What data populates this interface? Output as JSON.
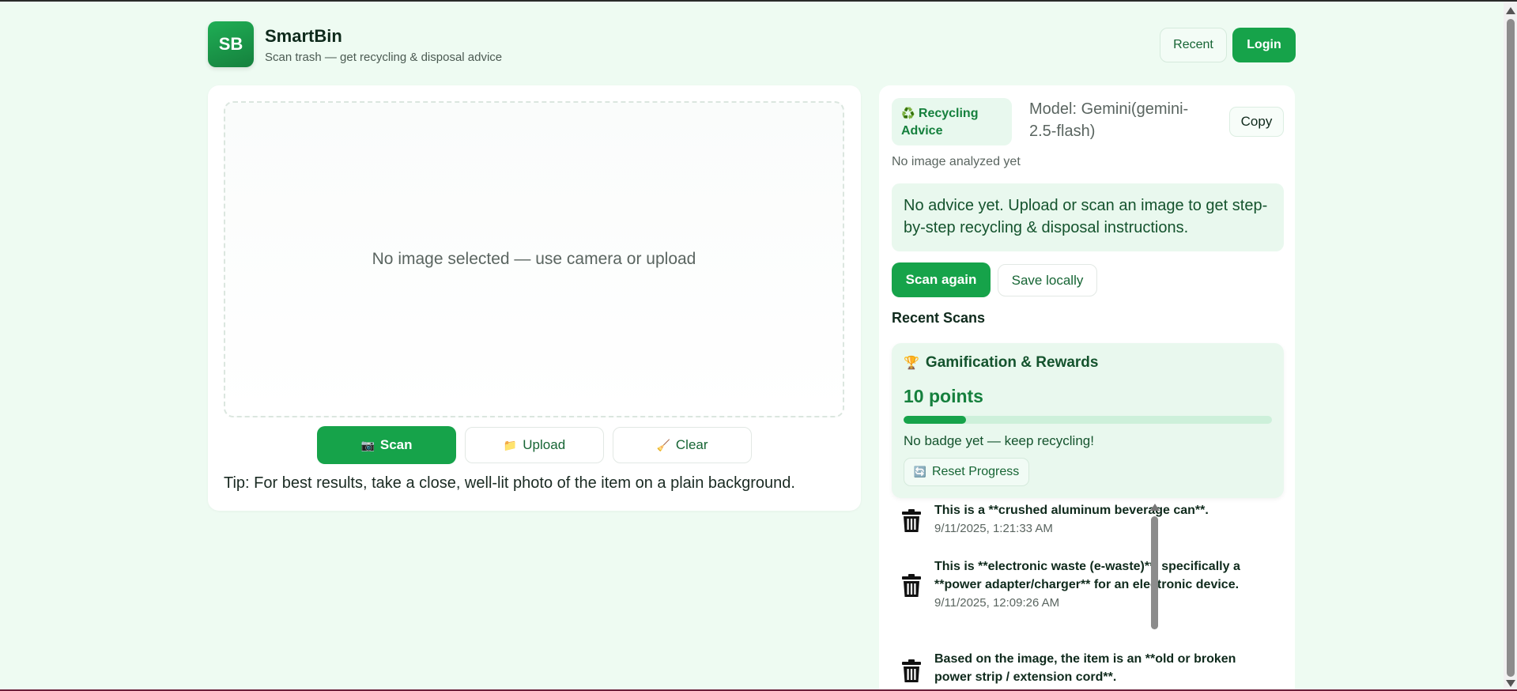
{
  "header": {
    "logo_text": "SB",
    "title": "SmartBin",
    "subtitle": "Scan trash — get recycling & disposal advice",
    "recent_label": "Recent",
    "login_label": "Login"
  },
  "scanner": {
    "placeholder": "No image selected — use camera or upload",
    "scan_icon": "📷",
    "scan_label": "Scan",
    "upload_icon": "📁",
    "upload_label": "Upload",
    "clear_icon": "🧹",
    "clear_label": "Clear",
    "tip": "Tip: For best results, take a close, well-lit photo of the item on a plain background."
  },
  "advice": {
    "pill_icon": "♻️",
    "pill_label": "Recycling Advice",
    "model": "Model: Gemini(gemini-2.5-flash)",
    "copy_label": "Copy",
    "status": "No image analyzed yet",
    "message": "No advice yet. Upload or scan an image to get step-by-step recycling & disposal instructions.",
    "scan_again_label": "Scan again",
    "save_label": "Save locally",
    "recent_heading": "Recent Scans"
  },
  "gamification": {
    "icon": "🏆",
    "title": "Gamification & Rewards",
    "points": "10 points",
    "progress": 0.17,
    "badge_text": "No badge yet — keep recycling!",
    "reset_icon": "🔄",
    "reset_label": "Reset Progress"
  },
  "scans": [
    {
      "text": "This is a **crushed aluminum beverage can**.",
      "date": "9/11/2025, 1:21:33 AM"
    },
    {
      "text": "This is **electronic waste (e-waste)**, specifically a **power adapter/charger** for an electronic device.",
      "date": "9/11/2025, 12:09:26 AM"
    },
    {
      "text": "Based on the image, the item is an **old or broken power strip / extension cord**.",
      "date": ""
    }
  ],
  "colors": {
    "brand": "#16a34a",
    "background": "#eefbf2",
    "panel_tint": "#e9f8ee"
  }
}
